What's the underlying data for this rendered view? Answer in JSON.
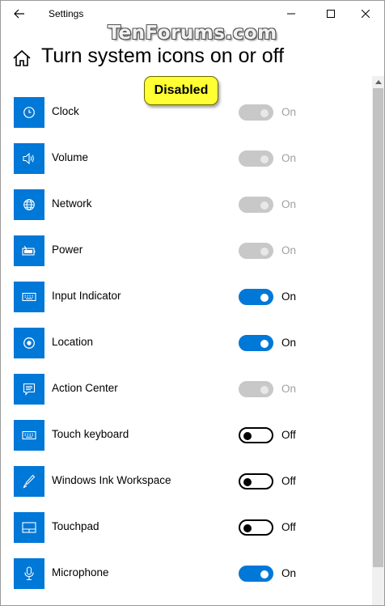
{
  "window": {
    "title": "Settings"
  },
  "watermark": "TenForums.com",
  "page": {
    "title": "Turn system icons on or off"
  },
  "callout": {
    "text": "Disabled"
  },
  "items": [
    {
      "label": "Clock",
      "icon": "clock-icon",
      "state": "On",
      "toggle": "disabled"
    },
    {
      "label": "Volume",
      "icon": "volume-icon",
      "state": "On",
      "toggle": "disabled"
    },
    {
      "label": "Network",
      "icon": "network-icon",
      "state": "On",
      "toggle": "disabled"
    },
    {
      "label": "Power",
      "icon": "power-icon",
      "state": "On",
      "toggle": "disabled"
    },
    {
      "label": "Input Indicator",
      "icon": "keyboard-icon",
      "state": "On",
      "toggle": "on"
    },
    {
      "label": "Location",
      "icon": "location-icon",
      "state": "On",
      "toggle": "on"
    },
    {
      "label": "Action Center",
      "icon": "action-center-icon",
      "state": "On",
      "toggle": "disabled"
    },
    {
      "label": "Touch keyboard",
      "icon": "touch-keyboard-icon",
      "state": "Off",
      "toggle": "off"
    },
    {
      "label": "Windows Ink Workspace",
      "icon": "pen-icon",
      "state": "Off",
      "toggle": "off"
    },
    {
      "label": "Touchpad",
      "icon": "touchpad-icon",
      "state": "Off",
      "toggle": "off"
    },
    {
      "label": "Microphone",
      "icon": "microphone-icon",
      "state": "On",
      "toggle": "on"
    }
  ],
  "colors": {
    "accent": "#0078d7",
    "callout": "#ffff33",
    "disabled": "#c8c8c8"
  }
}
